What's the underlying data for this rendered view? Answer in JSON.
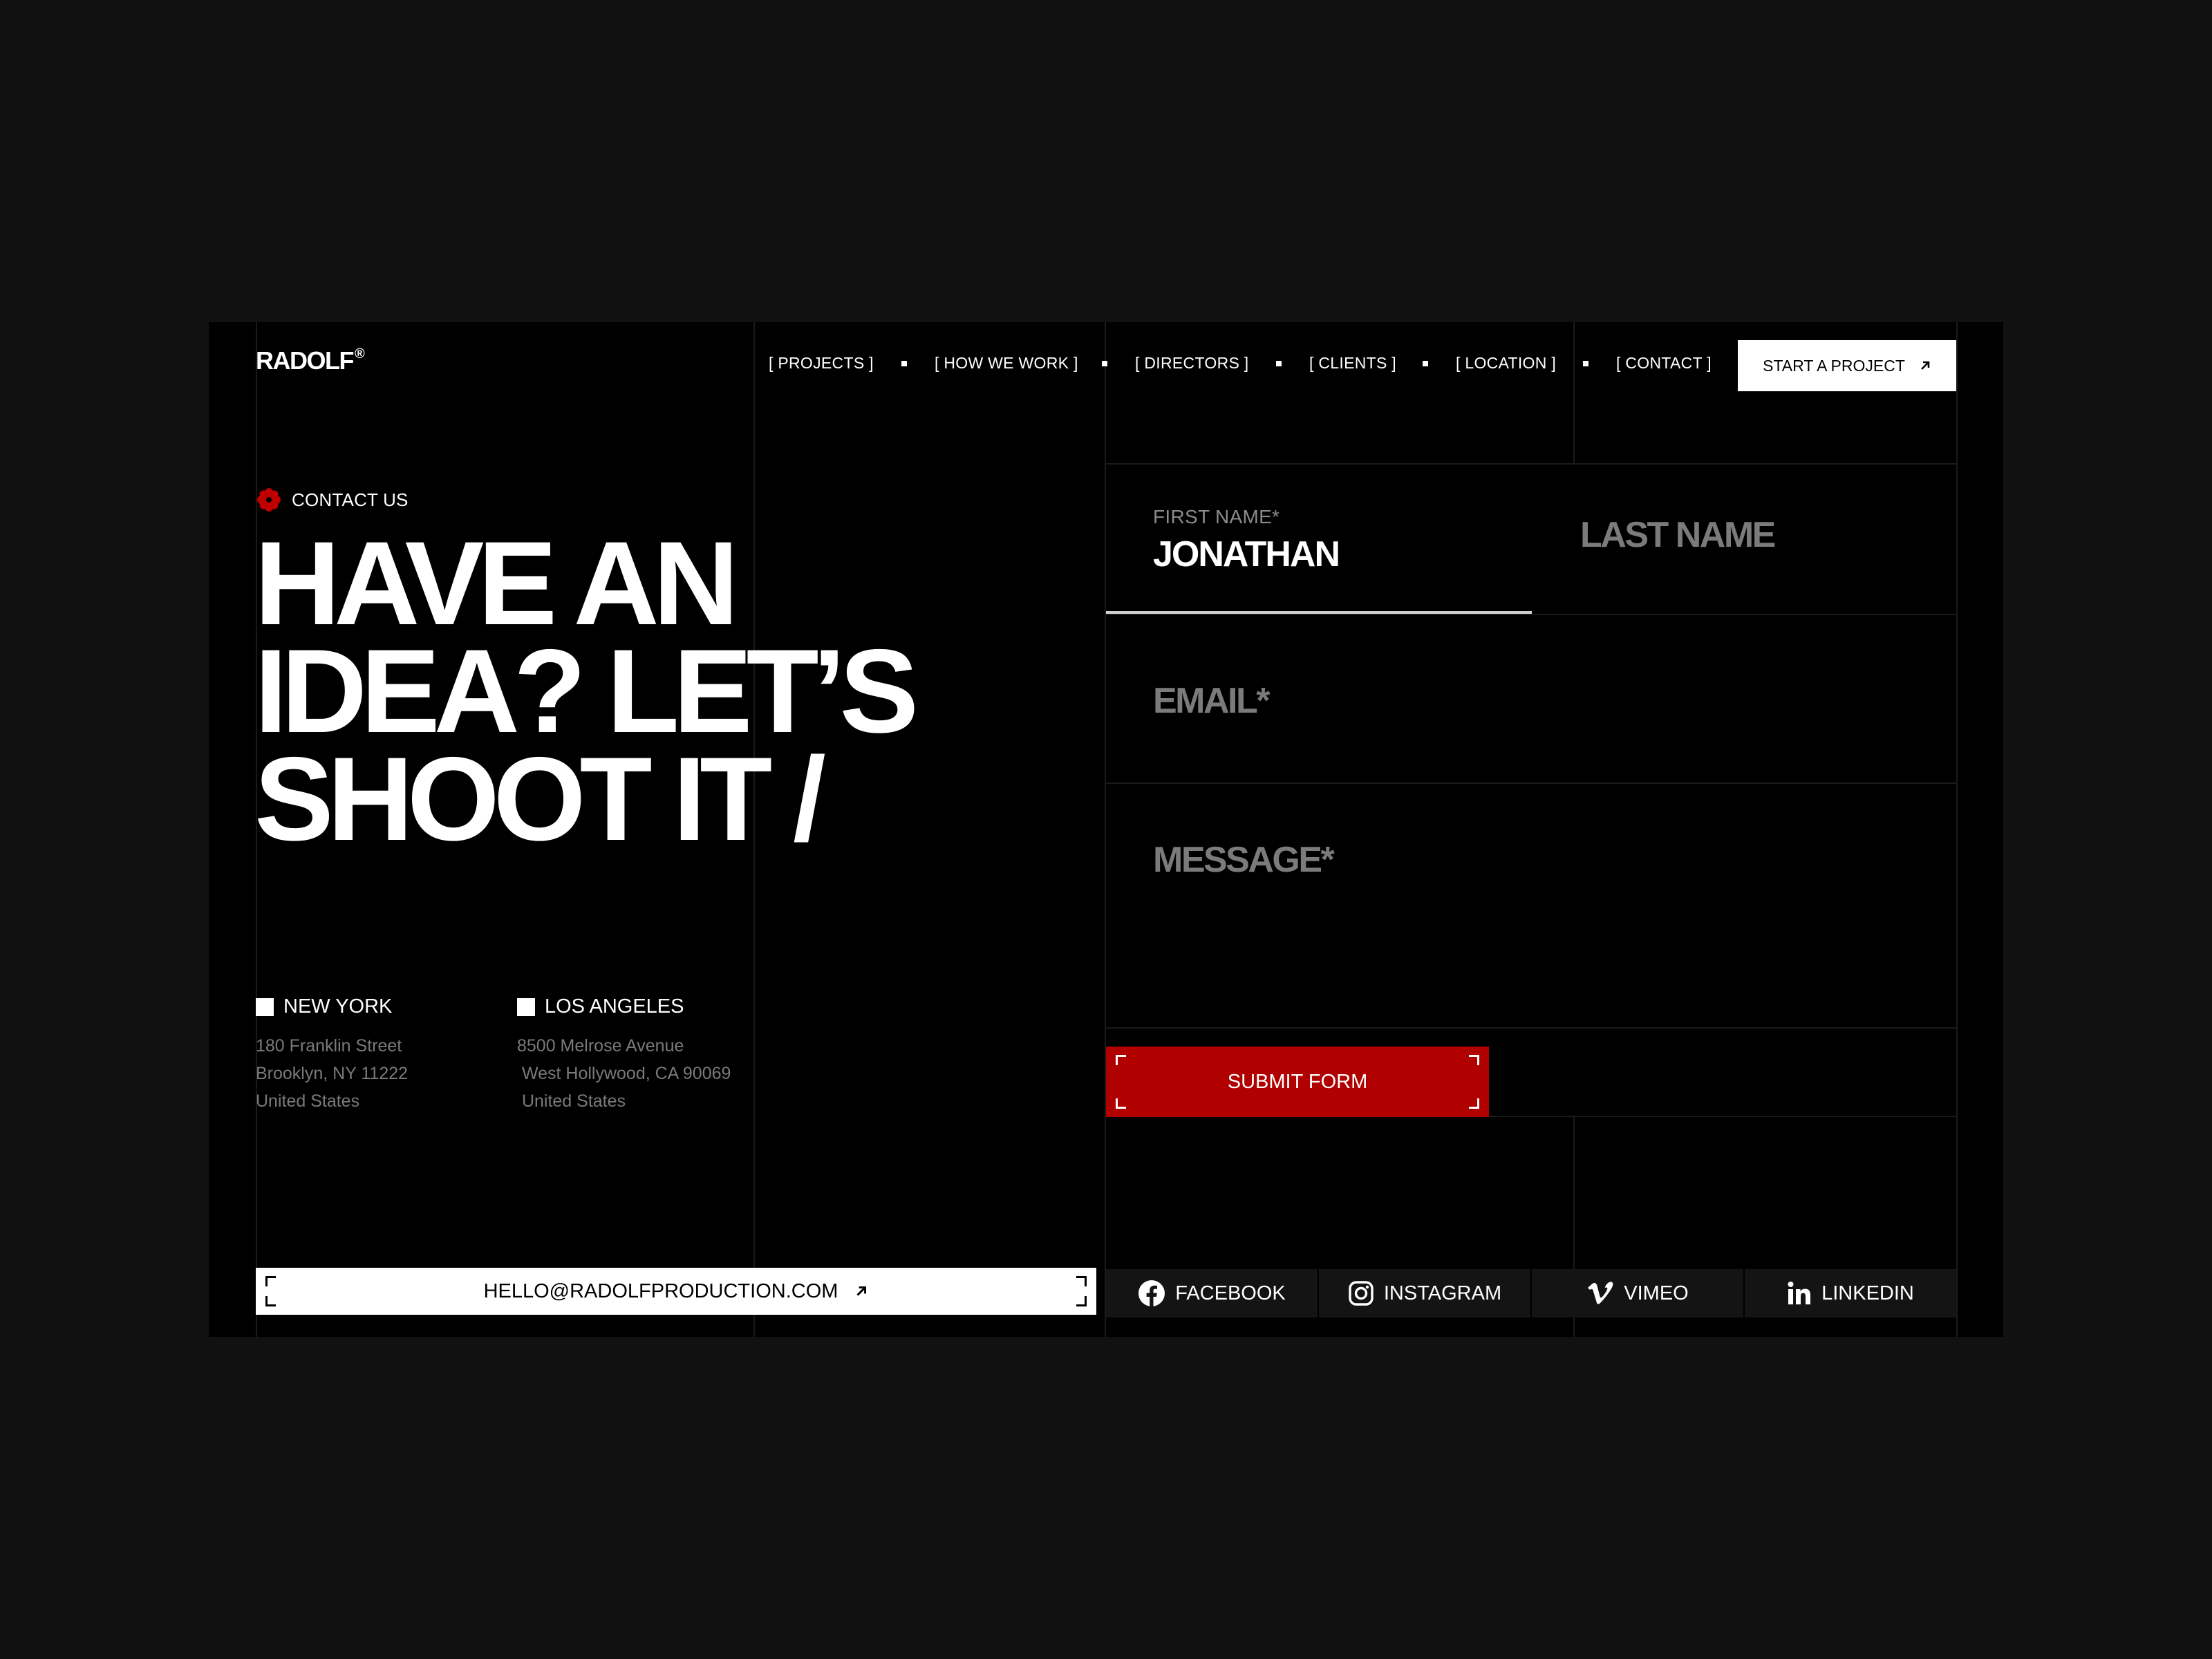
{
  "brand": {
    "name": "RADOLF",
    "mark": "®"
  },
  "nav": {
    "items": [
      "[ PROJECTS ]",
      "[ HOW WE WORK ]",
      "[ DIRECTORS ]",
      "[ CLIENTS ]",
      "[ LOCATION ]",
      "[ CONTACT ]"
    ],
    "cta_label": "START A PROJECT"
  },
  "hero": {
    "eyebrow": "CONTACT US",
    "headline": [
      "HAVE AN",
      "IDEA? LET’S",
      "SHOOT IT /"
    ]
  },
  "offices": [
    {
      "city": "NEW YORK",
      "address": [
        "180 Franklin Street",
        "Brooklyn, NY 11222",
        "United States"
      ]
    },
    {
      "city": "LOS ANGELES",
      "address": [
        "8500 Melrose Avenue",
        " West Hollywood, CA 90069",
        " United States"
      ]
    }
  ],
  "form": {
    "first_name_label": "FIRST NAME*",
    "first_name_value": "JONATHAN",
    "last_name_placeholder": "LAST NAME",
    "email_placeholder": "EMAIL*",
    "message_placeholder": "MESSAGE*",
    "submit_label": "SUBMIT FORM"
  },
  "contact_email": "HELLO@RADOLFPRODUCTION.COM",
  "socials": [
    "FACEBOOK",
    "INSTAGRAM",
    "VIMEO",
    "LINKEDIN"
  ],
  "colors": {
    "accent": "#b10000",
    "background": "#000000",
    "outer": "#111111",
    "muted": "#7b7b7b"
  },
  "icons": {
    "eyebrow": "red-flower-icon",
    "cta": "arrow-up-right-icon",
    "facebook": "facebook-icon",
    "instagram": "instagram-icon",
    "vimeo": "vimeo-icon",
    "linkedin": "linkedin-icon"
  }
}
